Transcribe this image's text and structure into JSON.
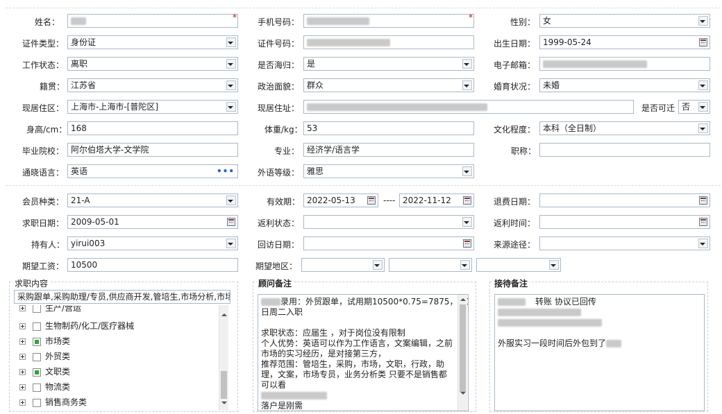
{
  "personal": {
    "name_label": "姓名：",
    "mobile_label": "手机号码：",
    "gender_label": "性别：",
    "gender": "女",
    "id_type_label": "证件类型：",
    "id_type": "身份证",
    "id_no_label": "证件号码：",
    "birth_label": "出生日期：",
    "birth": "1999-05-24",
    "work_status_label": "工作状态：",
    "work_status": "离职",
    "returnee_label": "是否海归：",
    "returnee": "是",
    "email_label": "电子邮箱：",
    "native_label": "籍贯：",
    "native": "江苏省",
    "political_label": "政治面貌：",
    "political": "群众",
    "marital_label": "婚育状况：",
    "marital": "未婚",
    "region_label": "现居住区：",
    "region": "上海市-上海市-[普陀区]",
    "address_label": "现居住址：",
    "relocate_label": "是否可迁",
    "relocate": "否",
    "height_label": "身高/cm：",
    "height": "168",
    "weight_label": "体重/kg：",
    "weight": "53",
    "education_label": "文化程度：",
    "education": "本科（全日制）",
    "school_label": "毕业院校：",
    "school": "阿尔伯塔大学-文学院",
    "major_label": "专业：",
    "major": "经济学/语言学",
    "title_label": "职称：",
    "title": "",
    "language_label": "通晓语言：",
    "language": "英语",
    "language_more": "•••",
    "lang_level_label": "外语等级：",
    "lang_level": "雅思",
    "required_mark": "*"
  },
  "member": {
    "type_label": "会员种类：",
    "type": "21-A",
    "valid_label": "有效期：",
    "valid_from": "2022-05-13",
    "valid_sep": "----",
    "valid_to": "2022-11-12",
    "refund_label": "退费日期：",
    "refund": "",
    "apply_label": "求职日期：",
    "apply": "2009-05-01",
    "rebate_status_label": "返利状态：",
    "rebate_status": "",
    "rebate_time_label": "返利时间：",
    "rebate_time": "",
    "holder_label": "持有人：",
    "holder": "yirui003",
    "visit_label": "回访日期：",
    "visit": "",
    "source_label": "来源途径：",
    "source": "",
    "salary_label": "期望工资：",
    "salary": "10500",
    "area_label": "期望地区："
  },
  "job_content": {
    "title": "求职内容",
    "summary": "采购跟单,采购助理/专员,供应商开发,管培生,市场分析,市场",
    "tree": [
      {
        "label": "生产/营运",
        "checked": false
      },
      {
        "label": "生物制药/化工/医疗器械",
        "checked": false
      },
      {
        "label": "市场类",
        "checked": true
      },
      {
        "label": "外贸类",
        "checked": false
      },
      {
        "label": "文职类",
        "checked": true
      },
      {
        "label": "物流类",
        "checked": false
      },
      {
        "label": "销售商务类",
        "checked": false
      }
    ]
  },
  "consultant_notes": {
    "title": "顾问备注",
    "lines": [
      "录用：外贸跟单，试用期10500*0.75=7875，9.13",
      "日周二入职",
      "",
      "求职状态：应届生 ，对于岗位没有限制",
      "个人优势：英语可以作为工作语言，文案编辑，之前",
      "市场的实习经历，是对接第三方，",
      "推荐范围：管培生，采购，市场，文职，行政，助",
      "理，文案，市场专员，业务分析类 只要不是销售都",
      "可以看",
      "",
      "落户是刚需"
    ]
  },
  "reception_notes": {
    "title": "接待备注",
    "line1": "转账  协议已回传",
    "line2": "外服实习一段时间后外包到了"
  },
  "colors": {
    "border": "#a9b8c6",
    "required": "#d40000",
    "checked": "#2ea53a",
    "link": "#2563c9"
  }
}
